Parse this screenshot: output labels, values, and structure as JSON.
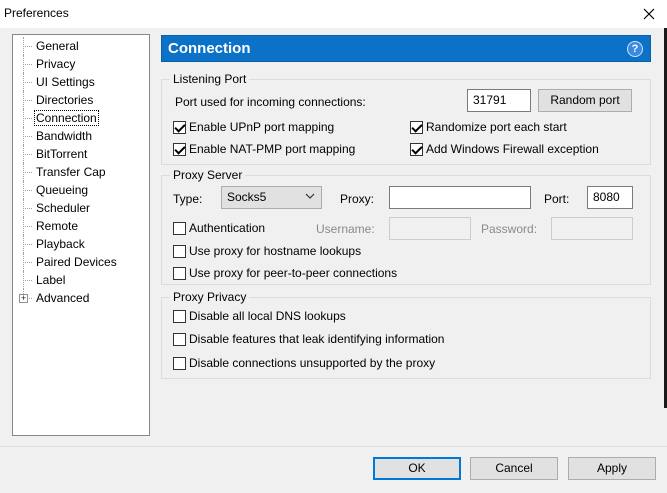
{
  "window": {
    "title": "Preferences"
  },
  "tree": {
    "items": [
      {
        "label": "General"
      },
      {
        "label": "Privacy"
      },
      {
        "label": "UI Settings"
      },
      {
        "label": "Directories"
      },
      {
        "label": "Connection"
      },
      {
        "label": "Bandwidth"
      },
      {
        "label": "BitTorrent"
      },
      {
        "label": "Transfer Cap"
      },
      {
        "label": "Queueing"
      },
      {
        "label": "Scheduler"
      },
      {
        "label": "Remote"
      },
      {
        "label": "Playback"
      },
      {
        "label": "Paired Devices"
      },
      {
        "label": "Label"
      },
      {
        "label": "Advanced"
      }
    ],
    "selected": "Connection",
    "expander_symbol": "+"
  },
  "header": {
    "title": "Connection",
    "help_symbol": "?"
  },
  "listening_port": {
    "legend": "Listening Port",
    "port_label": "Port used for incoming connections:",
    "port_value": "31791",
    "random_port_label": "Random port",
    "upnp_label": "Enable UPnP port mapping",
    "upnp_checked": true,
    "natpmp_label": "Enable NAT-PMP port mapping",
    "natpmp_checked": true,
    "randomize_label": "Randomize port each start",
    "randomize_checked": true,
    "firewall_label": "Add Windows Firewall exception",
    "firewall_checked": true
  },
  "proxy_server": {
    "legend": "Proxy Server",
    "type_label": "Type:",
    "type_value": "Socks5",
    "proxy_label": "Proxy:",
    "proxy_value": "",
    "port_label": "Port:",
    "port_value": "8080",
    "auth_label": "Authentication",
    "auth_checked": false,
    "username_label": "Username:",
    "password_label": "Password:",
    "hostname_lookup_label": "Use proxy for hostname lookups",
    "hostname_lookup_checked": false,
    "p2p_label": "Use proxy for peer-to-peer connections",
    "p2p_checked": false
  },
  "proxy_privacy": {
    "legend": "Proxy Privacy",
    "dns_label": "Disable all local DNS lookups",
    "dns_checked": false,
    "leak_label": "Disable features that leak identifying information",
    "leak_checked": false,
    "unsupported_label": "Disable connections unsupported by the proxy",
    "unsupported_checked": false
  },
  "footer": {
    "ok_label": "OK",
    "cancel_label": "Cancel",
    "apply_label": "Apply"
  },
  "colors": {
    "header_bg": "#0b72c8",
    "accent": "#0078d7"
  }
}
